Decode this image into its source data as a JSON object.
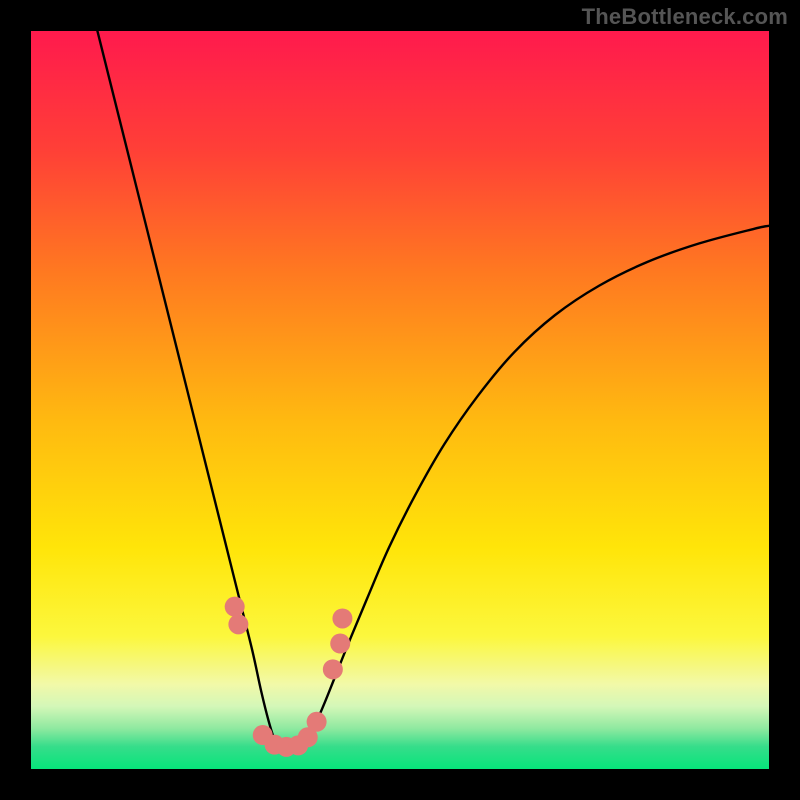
{
  "attribution": "TheBottleneck.com",
  "chart_data": {
    "type": "line",
    "title": "",
    "xlabel": "",
    "ylabel": "",
    "xlim": [
      0,
      100
    ],
    "ylim": [
      0,
      100
    ],
    "gradient_stops": [
      {
        "offset": 0.0,
        "color": "#ff1a4d"
      },
      {
        "offset": 0.16,
        "color": "#ff3f37"
      },
      {
        "offset": 0.33,
        "color": "#ff7a20"
      },
      {
        "offset": 0.53,
        "color": "#ffba10"
      },
      {
        "offset": 0.7,
        "color": "#ffe509"
      },
      {
        "offset": 0.82,
        "color": "#fcf73d"
      },
      {
        "offset": 0.885,
        "color": "#f2f9a8"
      },
      {
        "offset": 0.915,
        "color": "#d4f7b8"
      },
      {
        "offset": 0.945,
        "color": "#8fe9a0"
      },
      {
        "offset": 0.97,
        "color": "#35dd8a"
      },
      {
        "offset": 1.0,
        "color": "#07e57b"
      }
    ],
    "series": [
      {
        "name": "left-curve",
        "x": [
          9,
          10.5,
          12,
          13.5,
          15,
          16.5,
          18,
          19.5,
          21,
          22.5,
          24,
          25.5,
          27,
          28.5,
          30,
          31.2,
          32.2,
          33,
          33.7,
          34.3,
          35
        ],
        "y": [
          100,
          94,
          88,
          82,
          76,
          70,
          64,
          58,
          52,
          46,
          40,
          34,
          28,
          22,
          16,
          10.5,
          6.5,
          4.0,
          3.2,
          3.0,
          3.0
        ]
      },
      {
        "name": "right-curve",
        "x": [
          35,
          35.8,
          36.6,
          37.5,
          38.5,
          39.8,
          41.2,
          43,
          45.5,
          48.5,
          52,
          56,
          60.5,
          65.5,
          71,
          77,
          83.5,
          90.5,
          98,
          100
        ],
        "y": [
          3.0,
          3.0,
          3.2,
          4.0,
          6.0,
          9.0,
          12.5,
          17,
          23,
          30,
          37,
          44,
          50.5,
          56.5,
          61.5,
          65.5,
          68.7,
          71.2,
          73.2,
          73.6
        ]
      }
    ],
    "markers": {
      "name": "data-dots",
      "color": "#e47a77",
      "radius": 10,
      "points": [
        {
          "x": 27.6,
          "y": 22.0
        },
        {
          "x": 28.1,
          "y": 19.6
        },
        {
          "x": 31.4,
          "y": 4.6
        },
        {
          "x": 33.0,
          "y": 3.3
        },
        {
          "x": 34.6,
          "y": 3.0
        },
        {
          "x": 36.2,
          "y": 3.2
        },
        {
          "x": 37.5,
          "y": 4.3
        },
        {
          "x": 38.7,
          "y": 6.4
        },
        {
          "x": 40.9,
          "y": 13.5
        },
        {
          "x": 41.9,
          "y": 17.0
        },
        {
          "x": 42.2,
          "y": 20.4
        }
      ]
    }
  }
}
